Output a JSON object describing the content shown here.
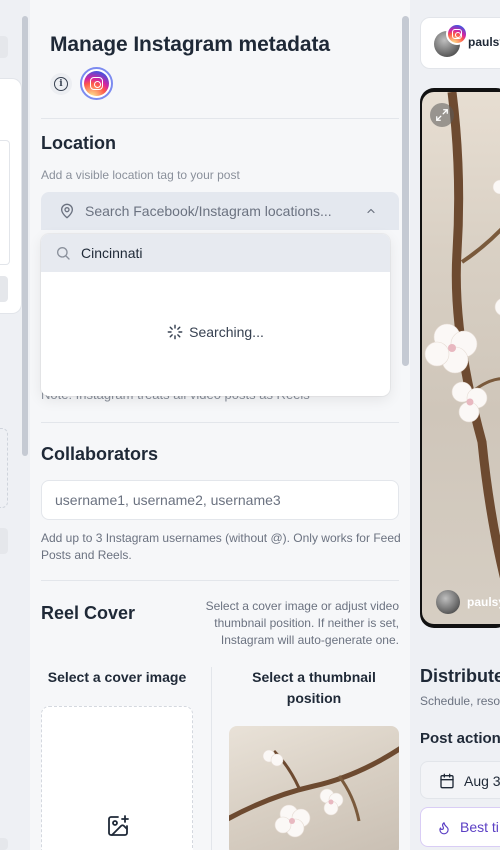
{
  "panel": {
    "title": "Manage Instagram metadata",
    "icons": {
      "info": "info-icon",
      "instagram": "instagram-icon"
    }
  },
  "location": {
    "title": "Location",
    "subtitle": "Add a visible location tag to your post",
    "placeholder": "Search Facebook/Instagram locations...",
    "search_value": "Cincinnati",
    "loading_text": "Searching..."
  },
  "note": "Note: Instagram treats all video posts as Reels",
  "collaborators": {
    "title": "Collaborators",
    "placeholder": "username1, username2, username3",
    "help": "Add up to 3 Instagram usernames (without @). Only works for Feed Posts and Reels."
  },
  "reel_cover": {
    "title": "Reel Cover",
    "help": "Select a cover image or adjust video thumbnail position. If neither is set, Instagram will auto-generate one.",
    "option_cover": "Select a cover image",
    "option_thumbnail": "Select a thumbnail position"
  },
  "preview": {
    "username": "paulsy",
    "distribute_title": "Distribute",
    "distribute_sub": "Schedule, reso",
    "post_action_label": "Post action",
    "date_label": "Aug 3",
    "best_time_label": "Best ti"
  },
  "colors": {
    "accent": "#5b3fc4",
    "instagram_ring": "#7c8bf0"
  }
}
